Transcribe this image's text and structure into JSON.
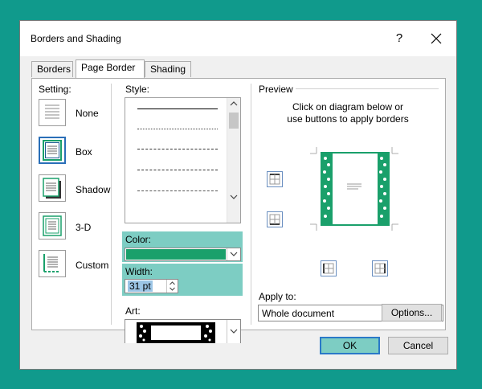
{
  "window": {
    "title": "Borders and Shading",
    "help": "?"
  },
  "tabs": [
    {
      "label": "Borders",
      "key": "B"
    },
    {
      "label": "Page Border",
      "key": "P"
    },
    {
      "label": "Shading",
      "key": "S"
    }
  ],
  "setting": {
    "label": "Setting:",
    "options": [
      {
        "label": "None"
      },
      {
        "label": "Box"
      },
      {
        "label": "Shadow"
      },
      {
        "label": "3-D"
      },
      {
        "label": "Custom"
      }
    ]
  },
  "style": {
    "label": "Style:"
  },
  "color": {
    "label": "Color:",
    "value_hex": "#1aa06b"
  },
  "width": {
    "label": "Width:",
    "value": "31 pt"
  },
  "art": {
    "label": "Art:"
  },
  "preview": {
    "label": "Preview",
    "instruction_line1": "Click on diagram below or",
    "instruction_line2": "use buttons to apply borders"
  },
  "apply_to": {
    "label": "Apply to:",
    "value": "Whole document"
  },
  "buttons": {
    "options": "Options...",
    "ok": "OK",
    "cancel": "Cancel"
  },
  "colors": {
    "background": "#109a8c",
    "highlight": "#7dcdc3",
    "border_art": "#1aa06b",
    "selection": "#2a6fb8"
  }
}
